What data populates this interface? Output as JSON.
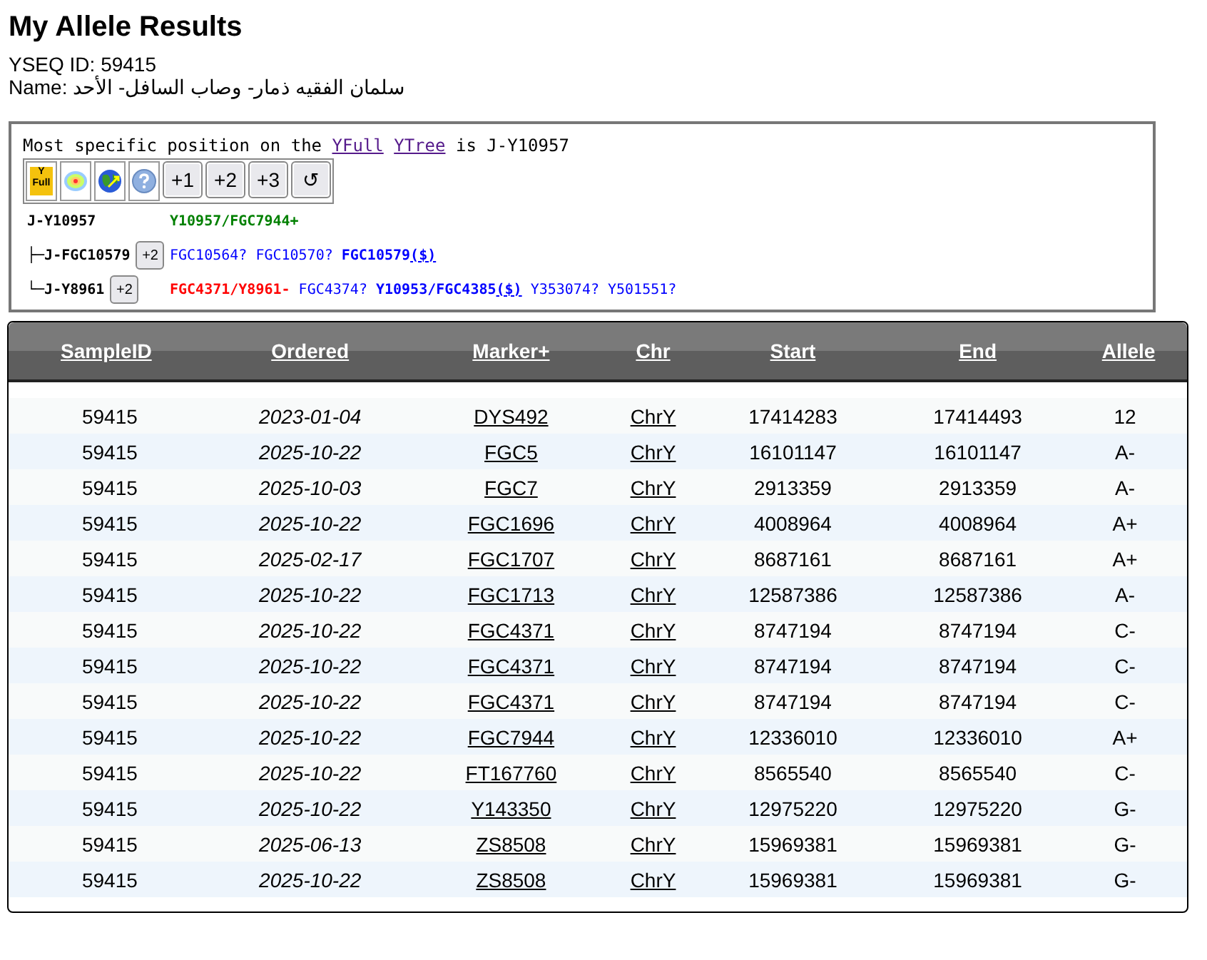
{
  "title": "My Allele Results",
  "yseq_id": "YSEQ ID: 59415",
  "name": "Name: سلمان الفقيه ذمار- وصاب السافل- الأحد",
  "tree_panel": {
    "intro": "Most specific position on the",
    "links": [
      "YFull",
      "YTree"
    ],
    "position": "is J-Y10957",
    "tools": [
      {
        "kind": "yfull",
        "label": "Y\nFull"
      },
      {
        "kind": "map"
      },
      {
        "kind": "globe"
      },
      {
        "kind": "help"
      },
      {
        "kind": "button",
        "label": "+1"
      },
      {
        "kind": "button",
        "label": "+2"
      },
      {
        "kind": "button",
        "label": "+3"
      },
      {
        "kind": "button",
        "label": "↺"
      }
    ],
    "nodes": [
      {
        "name": "J-Y10957",
        "snps": [
          {
            "kind": "positive",
            "text": "Y10957/FGC7944+"
          }
        ]
      },
      {
        "prefix": "├─",
        "name": "J-FGC10579",
        "button": "+2",
        "snps": [
          {
            "kind": "unknown",
            "text": "FGC10564?"
          },
          {
            "kind": "unknown",
            "text": "FGC10570?"
          },
          {
            "kind": "derived",
            "text": "FGC10579",
            "link": "($)"
          }
        ]
      },
      {
        "prefix": "└─",
        "name": "J-Y8961",
        "button": "+2",
        "snps": [
          {
            "kind": "negative",
            "text": "FGC4371/Y8961-"
          },
          {
            "kind": "unknown",
            "text": "FGC4374?"
          },
          {
            "kind": "derived",
            "text": "Y10953/FGC4385",
            "link": "($)"
          },
          {
            "kind": "unknown",
            "text": "Y353074?"
          },
          {
            "kind": "unknown",
            "text": "Y501551?"
          }
        ]
      }
    ]
  },
  "table": {
    "columns": [
      "SampleID",
      "Ordered",
      "Marker+",
      "Chr",
      "Start",
      "End",
      "Allele"
    ],
    "rows": [
      [
        "59415",
        "2023-01-04",
        "DYS492",
        "ChrY",
        "17414283",
        "17414493",
        "12"
      ],
      [
        "59415",
        "2025-10-22",
        "FGC5",
        "ChrY",
        "16101147",
        "16101147",
        "A-"
      ],
      [
        "59415",
        "2025-10-03",
        "FGC7",
        "ChrY",
        "2913359",
        "2913359",
        "A-"
      ],
      [
        "59415",
        "2025-10-22",
        "FGC1696",
        "ChrY",
        "4008964",
        "4008964",
        "A+"
      ],
      [
        "59415",
        "2025-02-17",
        "FGC1707",
        "ChrY",
        "8687161",
        "8687161",
        "A+"
      ],
      [
        "59415",
        "2025-10-22",
        "FGC1713",
        "ChrY",
        "12587386",
        "12587386",
        "A-"
      ],
      [
        "59415",
        "2025-10-22",
        "FGC4371",
        "ChrY",
        "8747194",
        "8747194",
        "C-"
      ],
      [
        "59415",
        "2025-10-22",
        "FGC4371",
        "ChrY",
        "8747194",
        "8747194",
        "C-"
      ],
      [
        "59415",
        "2025-10-22",
        "FGC4371",
        "ChrY",
        "8747194",
        "8747194",
        "C-"
      ],
      [
        "59415",
        "2025-10-22",
        "FGC7944",
        "ChrY",
        "12336010",
        "12336010",
        "A+"
      ],
      [
        "59415",
        "2025-10-22",
        "FT167760",
        "ChrY",
        "8565540",
        "8565540",
        "C-"
      ],
      [
        "59415",
        "2025-10-22",
        "Y143350",
        "ChrY",
        "12975220",
        "12975220",
        "G-"
      ],
      [
        "59415",
        "2025-06-13",
        "ZS8508",
        "ChrY",
        "15969381",
        "15969381",
        "G-"
      ],
      [
        "59415",
        "2025-10-22",
        "ZS8508",
        "ChrY",
        "15969381",
        "15969381",
        "G-"
      ]
    ]
  }
}
